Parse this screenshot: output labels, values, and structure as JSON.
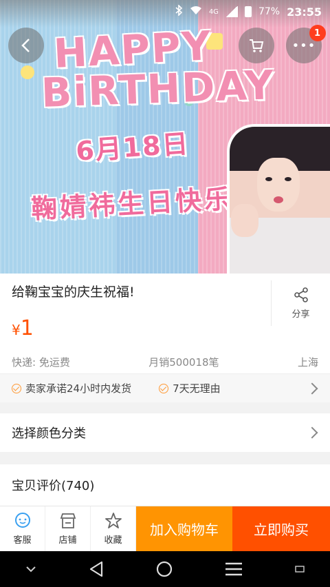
{
  "status_bar": {
    "network": "4G",
    "battery": "77%",
    "time": "23:55"
  },
  "hero": {
    "line1": "HAPPY",
    "line2": "BiRTHDAY",
    "date": "6月18日",
    "caption": "鞠婧祎生日快乐",
    "cart_badge": "1"
  },
  "product": {
    "title": "给鞠宝宝的庆生祝福!",
    "share_label": "分享",
    "currency": "¥",
    "price": "1",
    "shipping": "快递: 免运费",
    "monthly_sales": "月销500018笔",
    "location": "上海"
  },
  "promises": [
    {
      "label": "卖家承诺24小时内发货"
    },
    {
      "label": "7天无理由"
    }
  ],
  "rows": {
    "color_select": "选择颜色分类",
    "reviews": "宝贝评价(740)"
  },
  "action_bar": {
    "service_label": "客服",
    "shop_label": "店铺",
    "favorite_label": "收藏",
    "add_to_cart": "加入购物车",
    "buy_now": "立即购买"
  },
  "colors": {
    "price": "#ff5000",
    "add_to_cart_bg": "#ff9402",
    "buy_now_bg": "#ff5000",
    "badge": "#ff3d1f"
  }
}
